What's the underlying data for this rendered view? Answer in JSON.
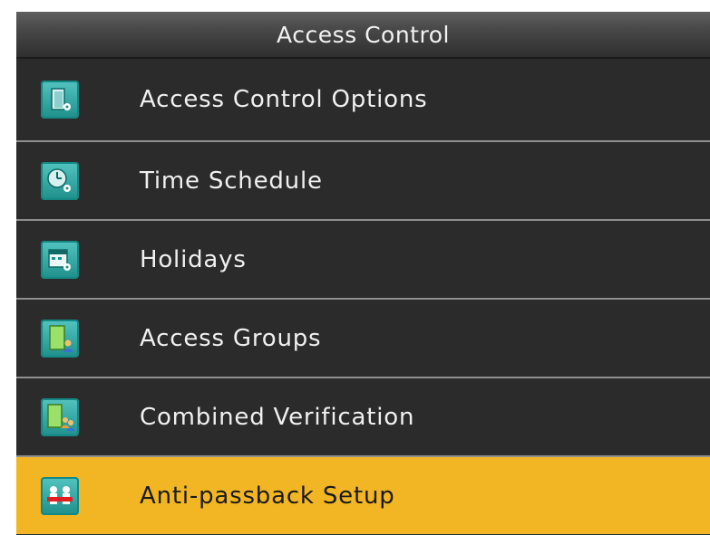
{
  "header": {
    "title": "Access Control"
  },
  "menu": {
    "items": [
      {
        "label": "Access Control Options",
        "icon": "door-settings-icon",
        "selected": false
      },
      {
        "label": "Time Schedule",
        "icon": "clock-settings-icon",
        "selected": false
      },
      {
        "label": "Holidays",
        "icon": "calendar-settings-icon",
        "selected": false
      },
      {
        "label": "Access Groups",
        "icon": "door-user-icon",
        "selected": false
      },
      {
        "label": "Combined Verification",
        "icon": "door-users-icon",
        "selected": false
      },
      {
        "label": "Anti-passback Setup",
        "icon": "anti-passback-icon",
        "selected": true
      }
    ]
  },
  "colors": {
    "background": "#2b2b2b",
    "highlight": "#f2b624",
    "icon": "#2aa8a4",
    "divider": "#8f8f8f"
  }
}
